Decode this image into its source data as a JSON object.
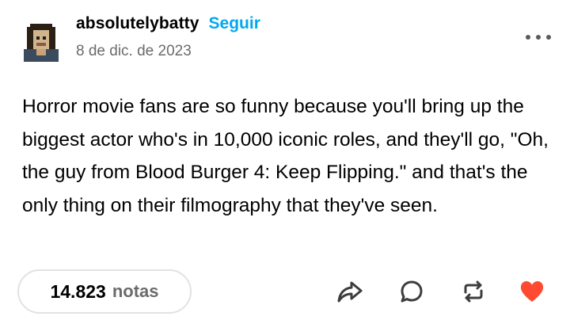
{
  "post": {
    "author": "absolutelybatty",
    "follow_label": "Seguir",
    "date": "8 de dic. de 2023",
    "body": "Horror movie fans are so funny because you'll bring up the biggest actor who's in 10,000 iconic roles, and they'll go, \"Oh, the guy from Blood Burger 4: Keep Flipping.\" and that's the only thing on their filmography that they've seen."
  },
  "footer": {
    "notes_count": "14.823",
    "notes_label": "notas"
  },
  "icons": {
    "avatar": "pixel-art-portrait",
    "more": "more-horizontal-icon",
    "share": "share-icon",
    "reply": "comment-icon",
    "reblog": "reblog-icon",
    "like": "heart-icon"
  },
  "colors": {
    "follow": "#00a8f0",
    "like": "#ff4930",
    "meta_text": "#6b6b6b",
    "icon": "#3d3d3d"
  }
}
